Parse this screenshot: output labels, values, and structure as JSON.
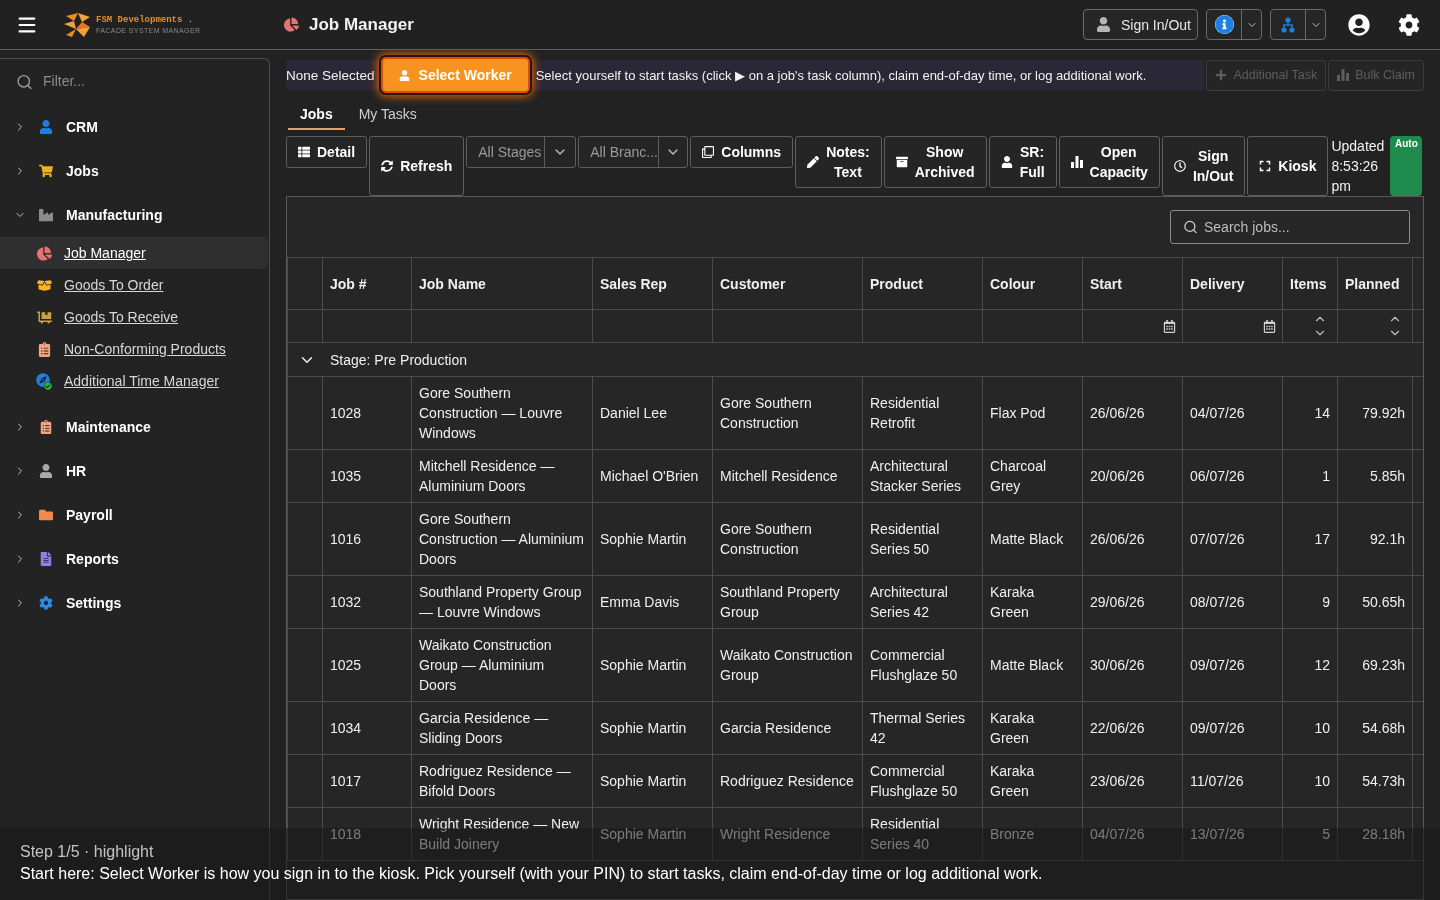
{
  "app_bar": {
    "brand": {
      "name": "FSM Developments .",
      "tagline": "FACADE SYSTEM MANAGER"
    },
    "page_title": "Job Manager",
    "sign_in_out": "Sign In/Out"
  },
  "sidebar": {
    "filter": {
      "placeholder": "Filter..."
    },
    "items": [
      {
        "label": "CRM",
        "expanded": false
      },
      {
        "label": "Jobs",
        "expanded": false
      },
      {
        "label": "Manufacturing",
        "expanded": true,
        "children": [
          {
            "label": "Job Manager",
            "selected": true
          },
          {
            "label": "Goods To Order",
            "selected": false
          },
          {
            "label": "Goods To Receive",
            "selected": false
          },
          {
            "label": "Non-Conforming Products",
            "selected": false
          },
          {
            "label": "Additional Time Manager",
            "selected": false
          }
        ]
      },
      {
        "label": "Maintenance",
        "expanded": false
      },
      {
        "label": "HR",
        "expanded": false
      },
      {
        "label": "Payroll",
        "expanded": false
      },
      {
        "label": "Reports",
        "expanded": false
      },
      {
        "label": "Settings",
        "expanded": false
      }
    ]
  },
  "worker_bar": {
    "status": "None Selected",
    "button": {
      "label": "Select Worker",
      "highlighted": true
    },
    "hint": "Select yourself to start tasks (click ▶ on a job's task column), claim end-of-day time, or log additional work.",
    "actions": [
      {
        "label": "Additional Task",
        "disabled": true
      },
      {
        "label": "Bulk Claim",
        "disabled": true
      }
    ]
  },
  "tabs": [
    {
      "label": "Jobs",
      "selected": true
    },
    {
      "label": "My Tasks",
      "selected": false
    }
  ],
  "toolbar": {
    "items": [
      {
        "kind": "button",
        "label": "Detail"
      },
      {
        "kind": "button",
        "label": "Refresh"
      },
      {
        "kind": "select",
        "value": "All Stages"
      },
      {
        "kind": "select",
        "value": "All Branc..."
      },
      {
        "kind": "button",
        "label": "Columns"
      },
      {
        "kind": "button",
        "label": "Notes: Text"
      },
      {
        "kind": "button",
        "label": "Show Archived"
      },
      {
        "kind": "button",
        "label": "SR: Full"
      },
      {
        "kind": "button",
        "label": "Open Capacity"
      },
      {
        "kind": "button",
        "label": "Sign In/Out"
      },
      {
        "kind": "button",
        "label": "Kiosk"
      }
    ],
    "updated": "Updated 8:53:26 pm",
    "auto_refresh": {
      "label": "Auto",
      "on": true
    }
  },
  "table": {
    "search": {
      "placeholder": "Search jobs..."
    },
    "columns": [
      {
        "label": "Job #",
        "kind": "text"
      },
      {
        "label": "Job Name",
        "kind": "text"
      },
      {
        "label": "Sales Rep",
        "kind": "text"
      },
      {
        "label": "Customer",
        "kind": "text"
      },
      {
        "label": "Product",
        "kind": "text"
      },
      {
        "label": "Colour",
        "kind": "text"
      },
      {
        "label": "Start",
        "kind": "date"
      },
      {
        "label": "Delivery",
        "kind": "date"
      },
      {
        "label": "Items",
        "kind": "number"
      },
      {
        "label": "Planned",
        "kind": "number"
      }
    ],
    "groups": [
      {
        "label": "Stage: Pre Production",
        "expanded": true,
        "rows": [
          [
            "1028",
            "Gore Southern Construction — Louvre Windows",
            "Daniel Lee",
            "Gore Southern Construction",
            "Residential Retrofit",
            "Flax Pod",
            "26/06/26",
            "04/07/26",
            "14",
            "79.92h"
          ],
          [
            "1035",
            "Mitchell Residence — Aluminium Doors",
            "Michael O'Brien",
            "Mitchell Residence",
            "Architectural Stacker Series",
            "Charcoal Grey",
            "20/06/26",
            "06/07/26",
            "1",
            "5.85h"
          ],
          [
            "1016",
            "Gore Southern Construction — Aluminium Doors",
            "Sophie Martin",
            "Gore Southern Construction",
            "Residential Series 50",
            "Matte Black",
            "26/06/26",
            "07/07/26",
            "17",
            "92.1h"
          ],
          [
            "1032",
            "Southland Property Group — Louvre Windows",
            "Emma Davis",
            "Southland Property Group",
            "Architectural Series 42",
            "Karaka Green",
            "29/06/26",
            "08/07/26",
            "9",
            "50.65h"
          ],
          [
            "1025",
            "Waikato Construction Group — Aluminium Doors",
            "Sophie Martin",
            "Waikato Construction Group",
            "Commercial Flushglaze 50",
            "Matte Black",
            "30/06/26",
            "09/07/26",
            "12",
            "69.23h"
          ],
          [
            "1034",
            "Garcia Residence — Sliding Doors",
            "Sophie Martin",
            "Garcia Residence",
            "Thermal Series 42",
            "Karaka Green",
            "22/06/26",
            "09/07/26",
            "10",
            "54.68h"
          ],
          [
            "1017",
            "Rodriguez Residence — Bifold Doors",
            "Sophie Martin",
            "Rodriguez Residence",
            "Commercial Flushglaze 50",
            "Karaka Green",
            "23/06/26",
            "11/07/26",
            "10",
            "54.73h"
          ],
          [
            "1018",
            "Wright Residence — New Build Joinery",
            "Sophie Martin",
            "Wright Residence",
            "Residential Series 40",
            "Bronze",
            "04/07/26",
            "13/07/26",
            "5",
            "28.18h"
          ]
        ]
      }
    ]
  },
  "tour": {
    "step": "Step 1/5 · highlight",
    "message": "Start here: Select Worker is how you sign in to the kiosk. Pick yourself (with your PIN) to start tasks, claim end-of-day time or log additional work."
  }
}
